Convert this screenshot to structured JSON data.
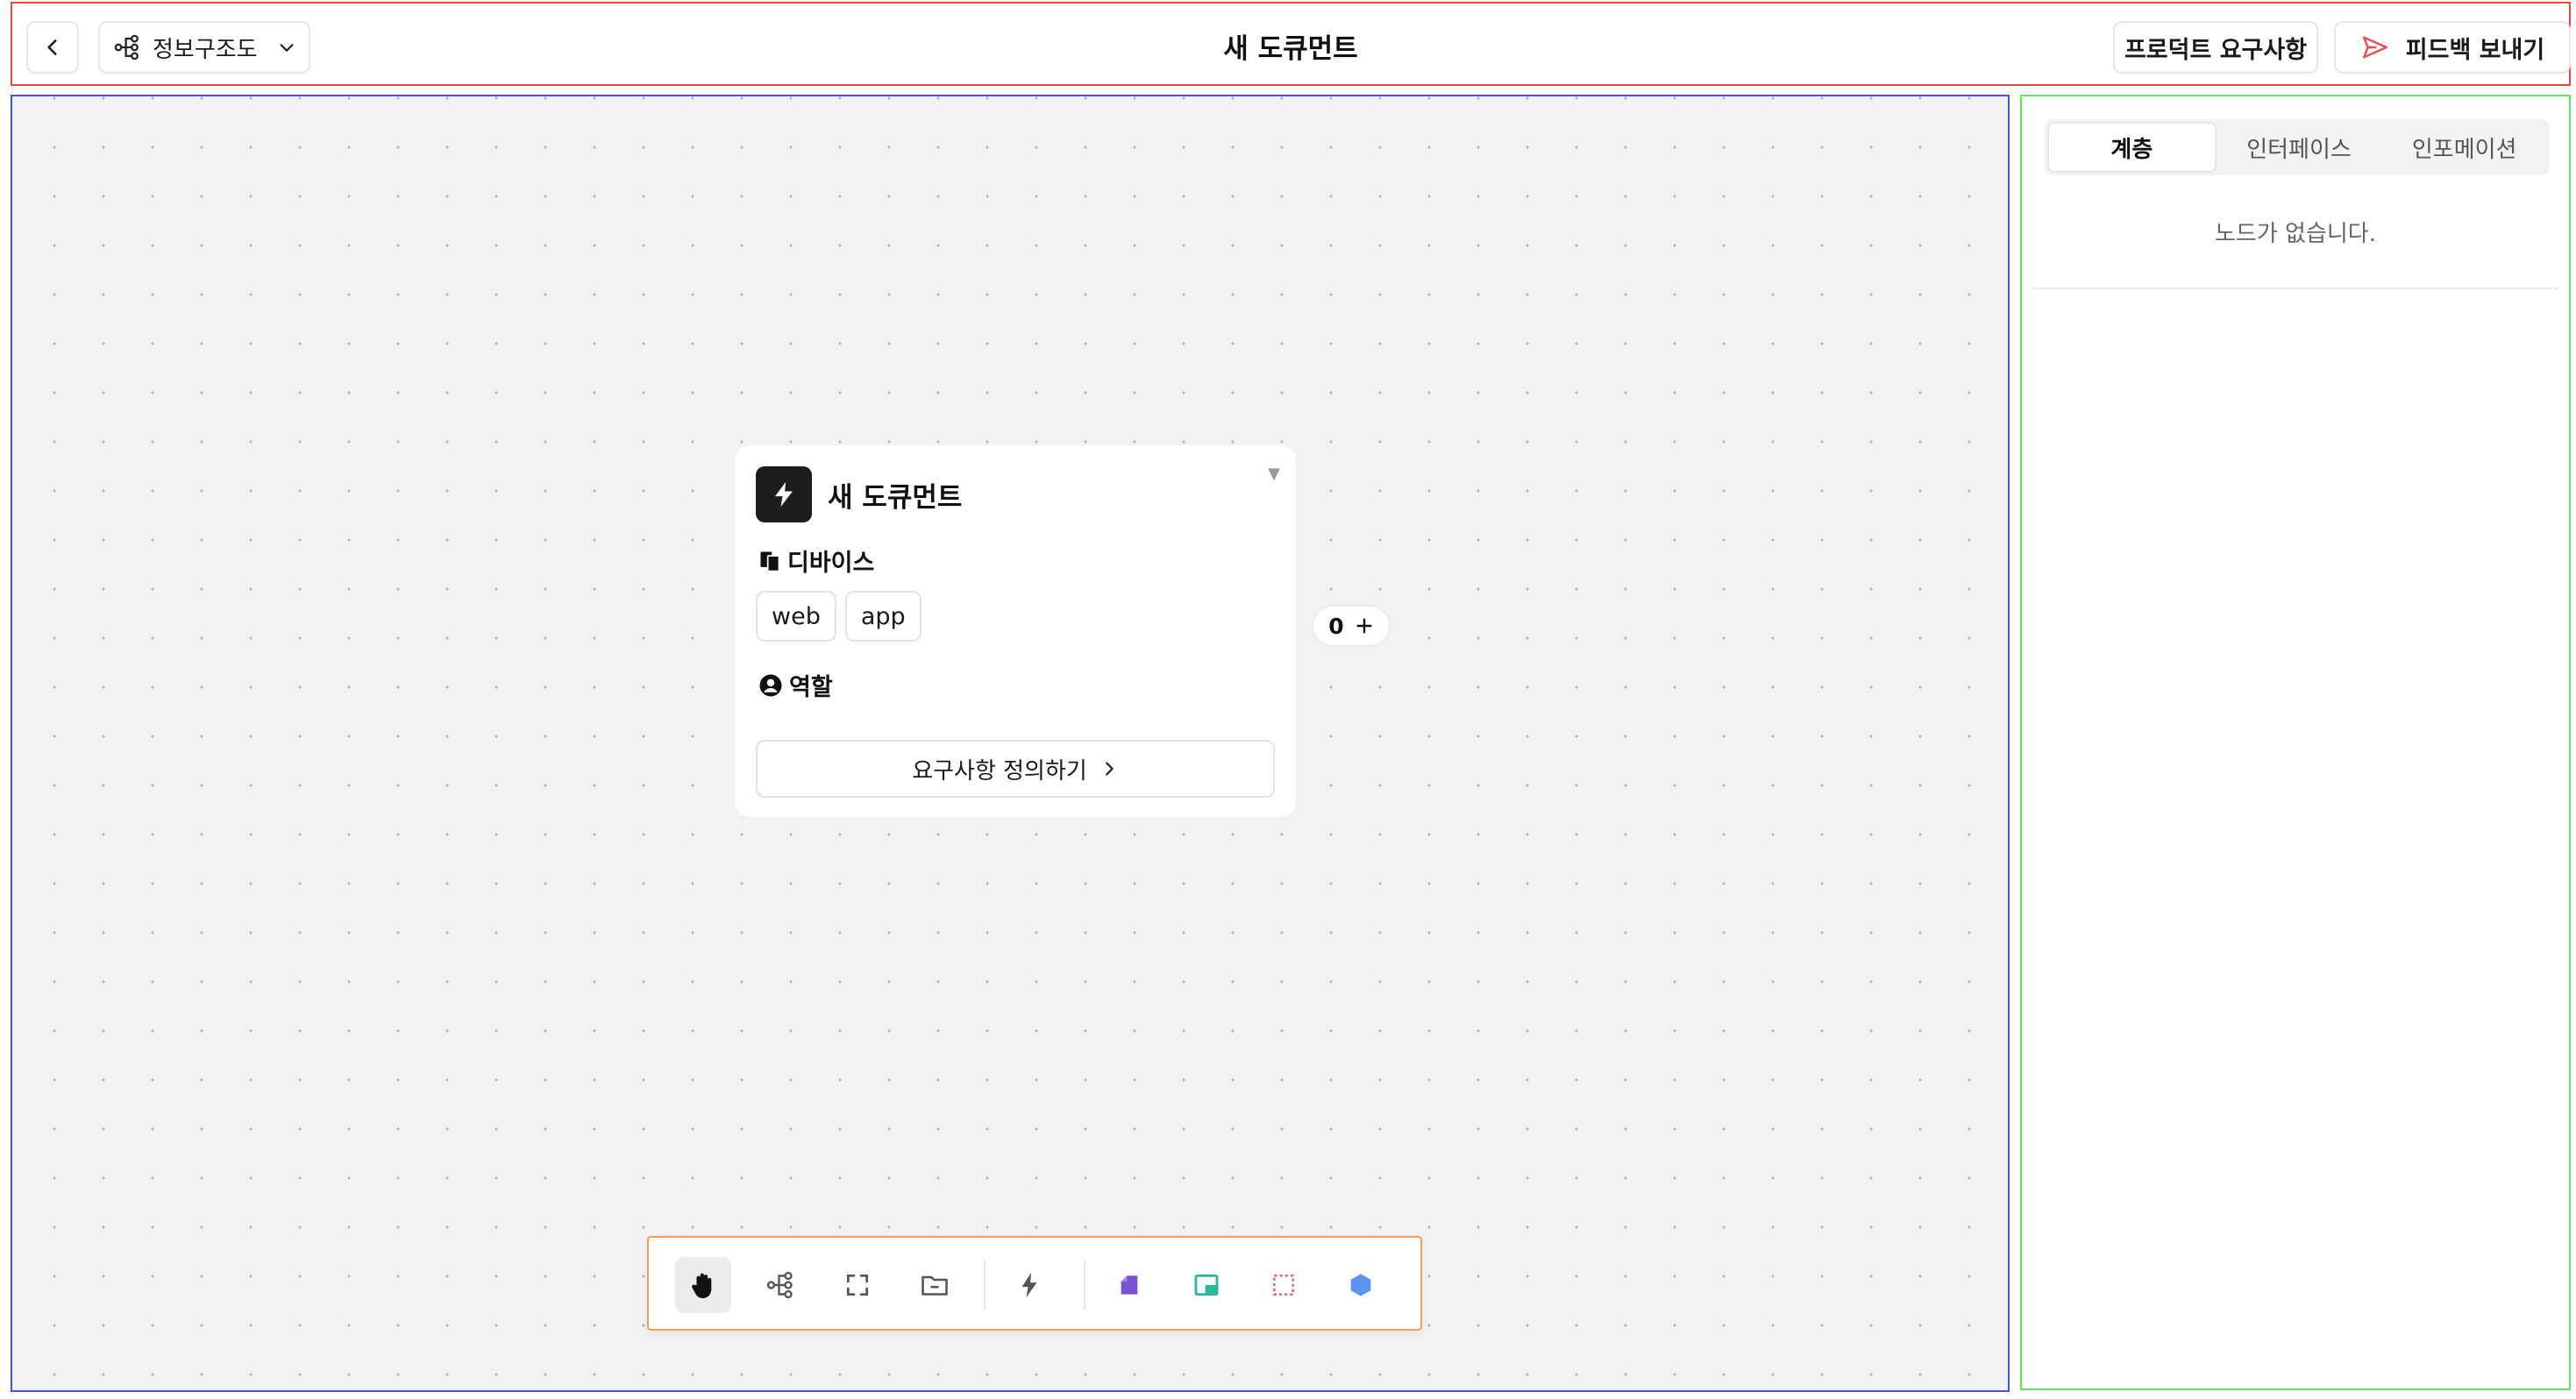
{
  "header": {
    "title": "새 도큐먼트",
    "view_selector_label": "정보구조도",
    "product_requirements_label": "프로덕트 요구사항",
    "feedback_label": "피드백 보내기"
  },
  "node": {
    "title": "새 도큐먼트",
    "devices_label": "디바이스",
    "devices": [
      "web",
      "app"
    ],
    "roles_label": "역할",
    "define_button_label": "요구사항 정의하기",
    "connection_count": "0"
  },
  "toolbar": {
    "tools": [
      "hand-icon",
      "hierarchy-icon",
      "frame-icon",
      "folder-icon",
      "lightning-icon",
      "note-icon",
      "screen-icon",
      "selection-icon",
      "hexagon-icon"
    ],
    "active_tool": "hand-icon"
  },
  "panel": {
    "tabs": [
      "계층",
      "인터페이스",
      "인포메이션"
    ],
    "active_tab": "계층",
    "empty_message": "노드가 없습니다."
  },
  "colors": {
    "header_border": "#ea4a3c",
    "canvas_border": "#4251e8",
    "panel_border": "#5fe65a",
    "toolbar_border": "#f0a34a",
    "feedback_icon": "#e8504a"
  }
}
